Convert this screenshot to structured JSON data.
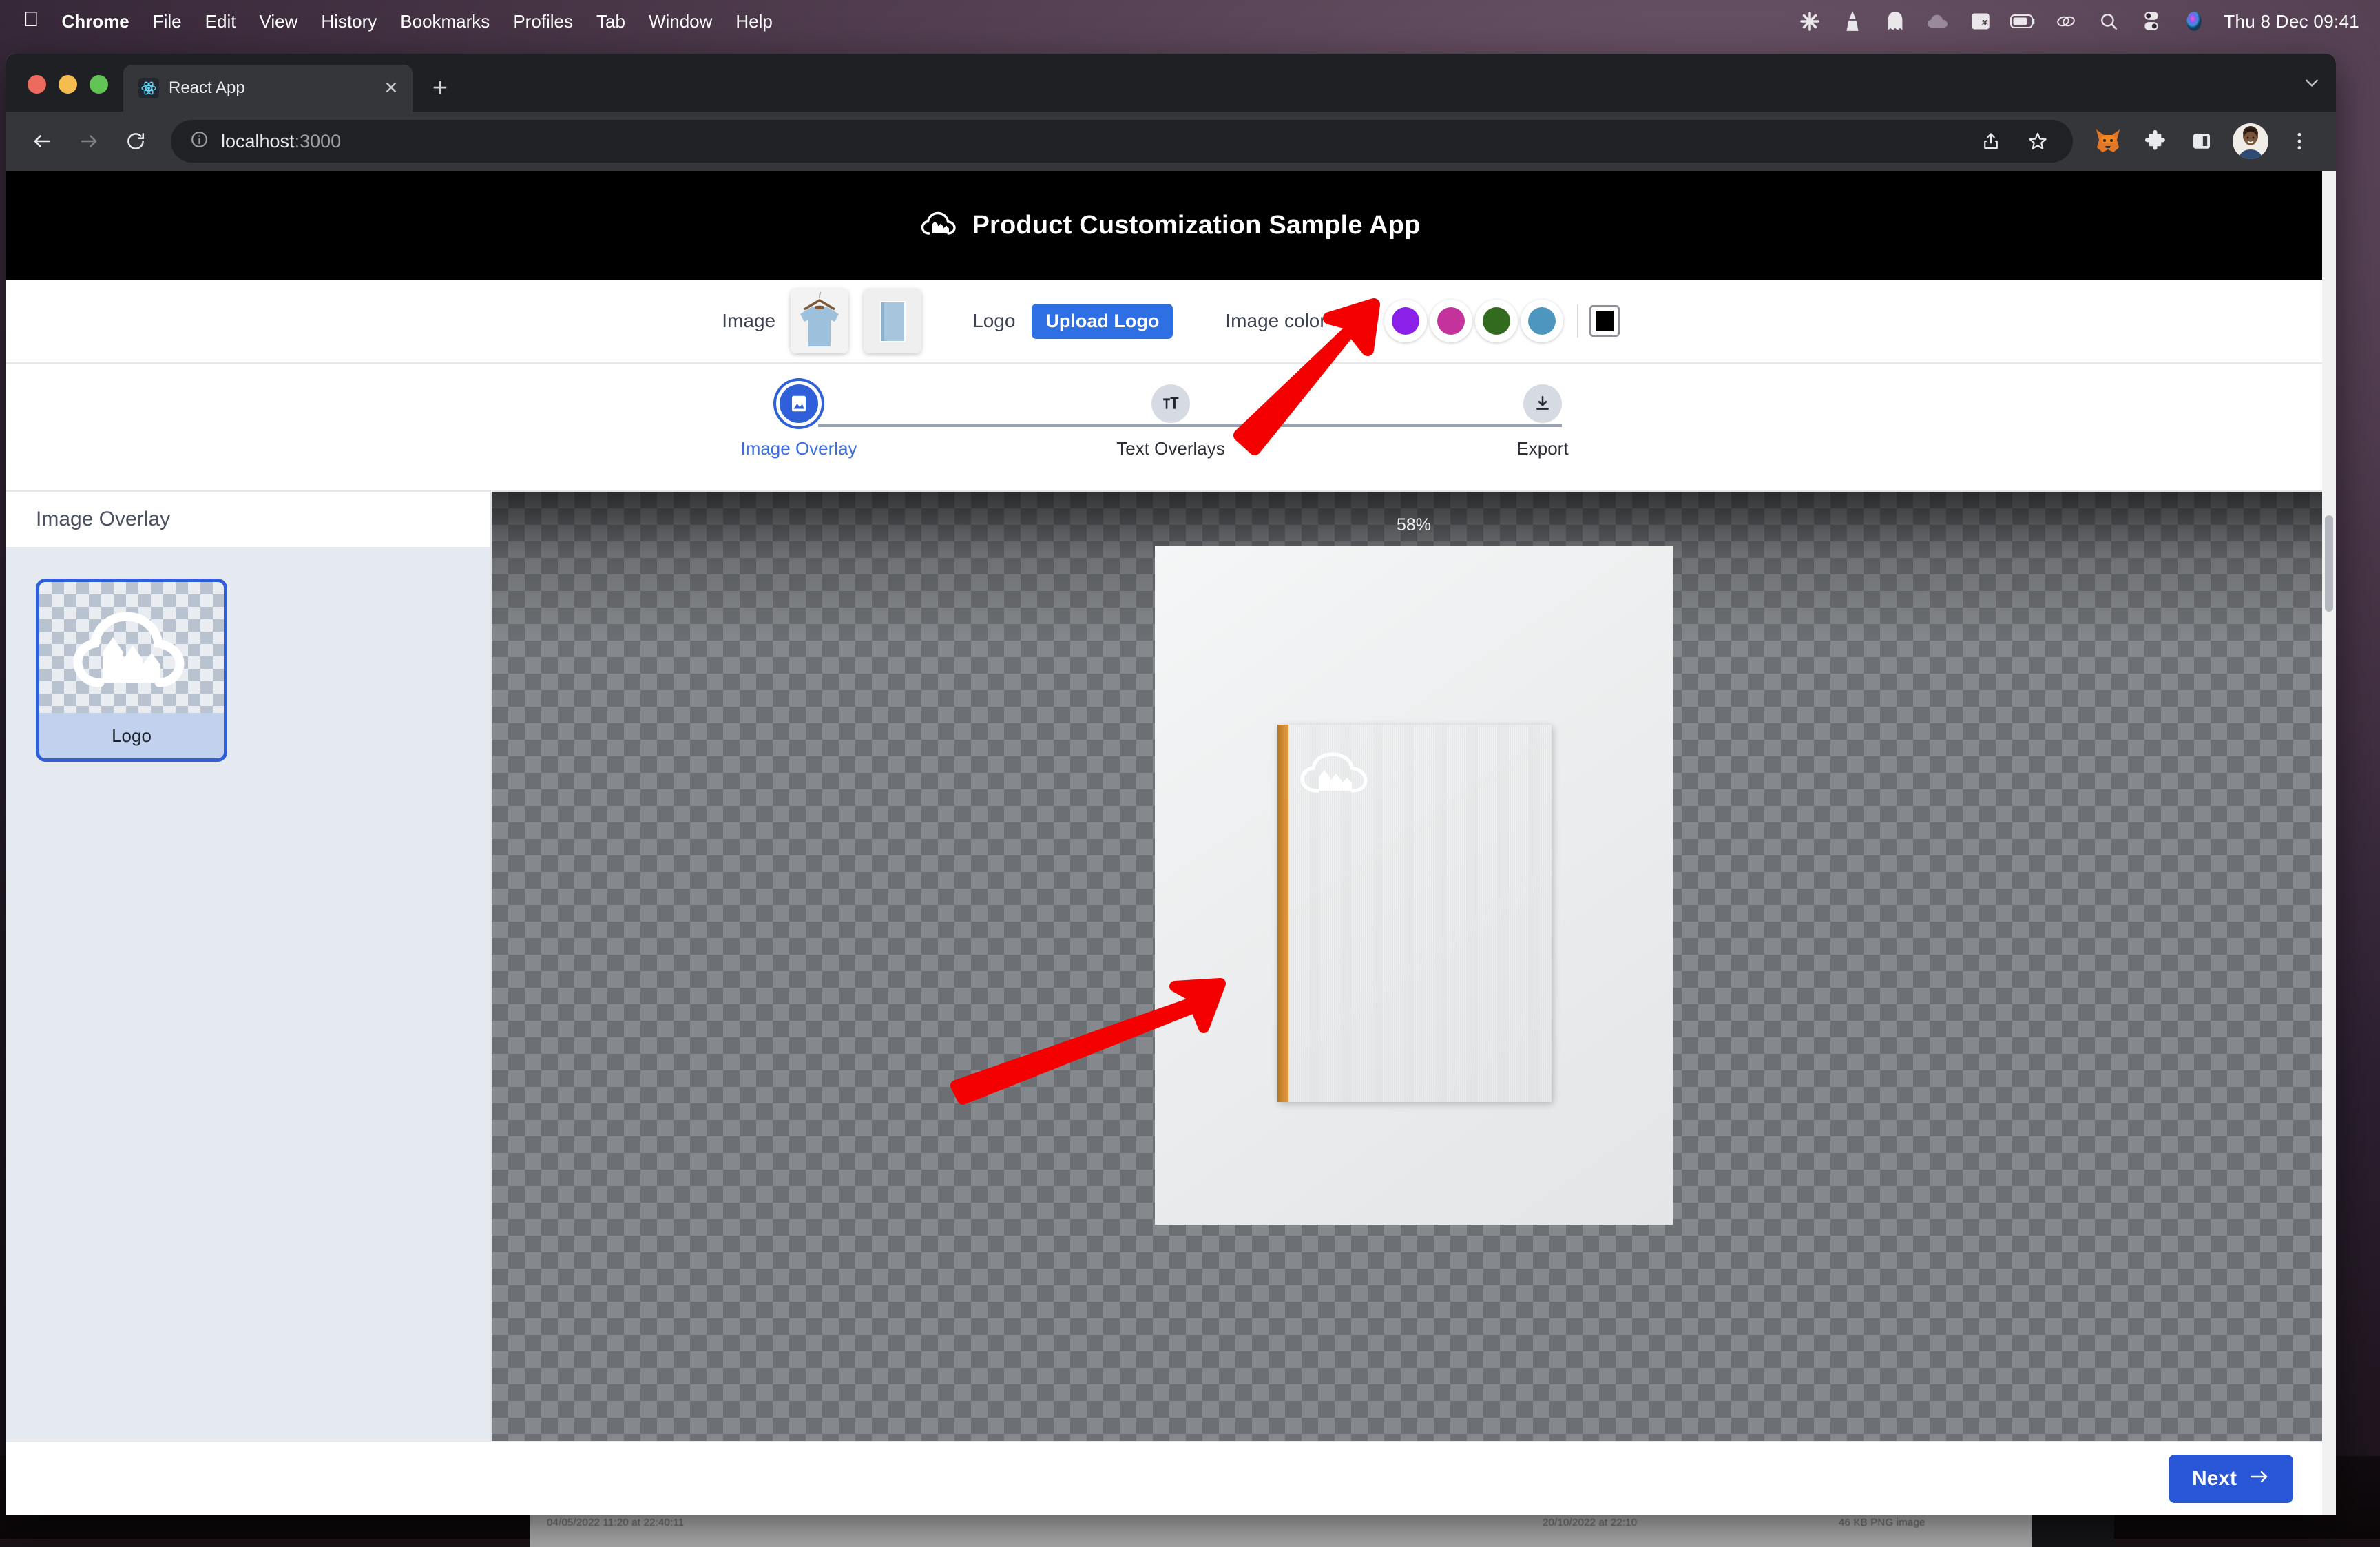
{
  "menubar": {
    "apple_icon": "apple-logo",
    "items": [
      {
        "label": "Chrome",
        "bold": true
      },
      {
        "label": "File",
        "bold": false
      },
      {
        "label": "Edit",
        "bold": false
      },
      {
        "label": "View",
        "bold": false
      },
      {
        "label": "History",
        "bold": false
      },
      {
        "label": "Bookmarks",
        "bold": false
      },
      {
        "label": "Profiles",
        "bold": false
      },
      {
        "label": "Tab",
        "bold": false
      },
      {
        "label": "Window",
        "bold": false
      },
      {
        "label": "Help",
        "bold": false
      }
    ],
    "status_icons": [
      "asterisk-snowflake-icon",
      "vlc-cone-icon",
      "ghost-icon",
      "cloud-icon",
      "command-window-icon",
      "battery-icon",
      "link-chain-icon",
      "search-icon",
      "control-center-icon",
      "siri-icon"
    ],
    "clock": "Thu 8 Dec  09:41"
  },
  "browser": {
    "tab": {
      "title": "React App",
      "favicon": "react-logo-icon",
      "close_icon": "close-icon"
    },
    "new_tab_icon": "plus-icon",
    "tab_list_icon": "chevron-down-icon",
    "nav": {
      "back_icon": "back-arrow-icon",
      "forward_icon": "forward-arrow-icon",
      "reload_icon": "reload-icon"
    },
    "omnibox": {
      "site_info_icon": "info-circle-icon",
      "url_host": "localhost",
      "url_port": ":3000",
      "share_icon": "share-icon",
      "bookmark_icon": "star-icon"
    },
    "toolbar_extras": [
      "metamask-fox-icon",
      "extensions-puzzle-icon",
      "side-panel-icon"
    ],
    "avatar": "profile-avatar",
    "menu_icon": "three-dot-menu-icon"
  },
  "app": {
    "header": {
      "logo_icon": "cloud-bars-logo",
      "title": "Product Customization Sample App"
    },
    "controls": {
      "image_label": "Image",
      "image_thumbnails": [
        {
          "name": "tshirt-thumbnail",
          "selected": false
        },
        {
          "name": "notebook-thumbnail",
          "selected": true
        }
      ],
      "logo_label": "Logo",
      "upload_logo_label": "Upload Logo",
      "image_color_label": "Image color",
      "swatches": [
        {
          "name": "orange",
          "hex": "#DD9238",
          "selected": true
        },
        {
          "name": "purple",
          "hex": "#8B20E8",
          "selected": false
        },
        {
          "name": "magenta",
          "hex": "#C4339B",
          "selected": false
        },
        {
          "name": "green",
          "hex": "#336B1E",
          "selected": false
        },
        {
          "name": "blue",
          "hex": "#4D96C0",
          "selected": false
        }
      ],
      "color_picker_icon": "color-picker-swatch-icon"
    },
    "stepper": {
      "steps": [
        {
          "label": "Image Overlay",
          "icon": "image-icon",
          "active": true
        },
        {
          "label": "Text Overlays",
          "icon": "text-size-icon",
          "active": false
        },
        {
          "label": "Export",
          "icon": "download-icon",
          "active": false
        }
      ]
    },
    "sidebar": {
      "header": "Image Overlay",
      "layers": [
        {
          "label": "Logo",
          "thumbnail": "cloud-arrows-logo",
          "selected": true
        }
      ]
    },
    "canvas": {
      "zoom_level": "58%",
      "product": "orange-hardcover-notebook",
      "product_logo": "cloud-arrows-logo"
    },
    "footer": {
      "next_label": "Next",
      "next_icon": "arrow-right-icon"
    },
    "accent_color": "#2856d6",
    "header_bg": "#000000"
  },
  "annotations": [
    {
      "name": "arrow-to-orange-swatch",
      "color": "#f50000"
    },
    {
      "name": "arrow-to-product-preview",
      "color": "#f50000"
    }
  ]
}
